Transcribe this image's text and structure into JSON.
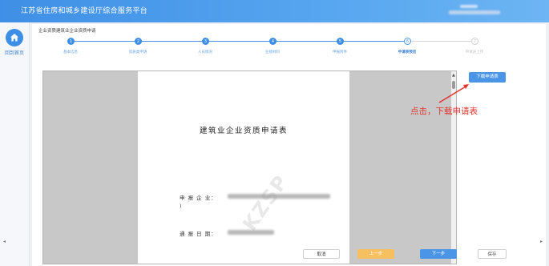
{
  "header": {
    "title": "江苏省住房和城乡建设厅综合服务平台"
  },
  "sidebar": {
    "home_label": "回到首页",
    "home_icon": "home-icon"
  },
  "breadcrumb": "企业资质建筑业企业资质申请",
  "steps": [
    {
      "num": "1",
      "label": "基本信息",
      "state": "done"
    },
    {
      "num": "2",
      "label": "资质类申请",
      "state": "done"
    },
    {
      "num": "3",
      "label": "人员情况",
      "state": "done"
    },
    {
      "num": "4",
      "label": "业绩材料",
      "state": "done"
    },
    {
      "num": "5",
      "label": "申报附件",
      "state": "done"
    },
    {
      "num": "6",
      "label": "申请表预览",
      "state": "current"
    },
    {
      "num": "7",
      "label": "申请表上传",
      "state": "todo"
    }
  ],
  "document": {
    "title": "建筑业企业资质申请表",
    "applicant_label": "申 报 企 业：",
    "applicant_suffix": ")",
    "date_label": "通 报 日 期：",
    "watermark": "KZSP"
  },
  "toolbar": {
    "download_label": "下载申请表"
  },
  "annotation": {
    "text": "点击，下载申请表",
    "color": "#e0342f"
  },
  "footer": {
    "cancel_label": "取消",
    "prev_label": "上一步",
    "next_label": "下一步",
    "save_label": "保存"
  },
  "colors": {
    "header_blue": "#3f8fe6",
    "accent_blue": "#4a95e6",
    "prev_orange": "#f6bf5f"
  }
}
